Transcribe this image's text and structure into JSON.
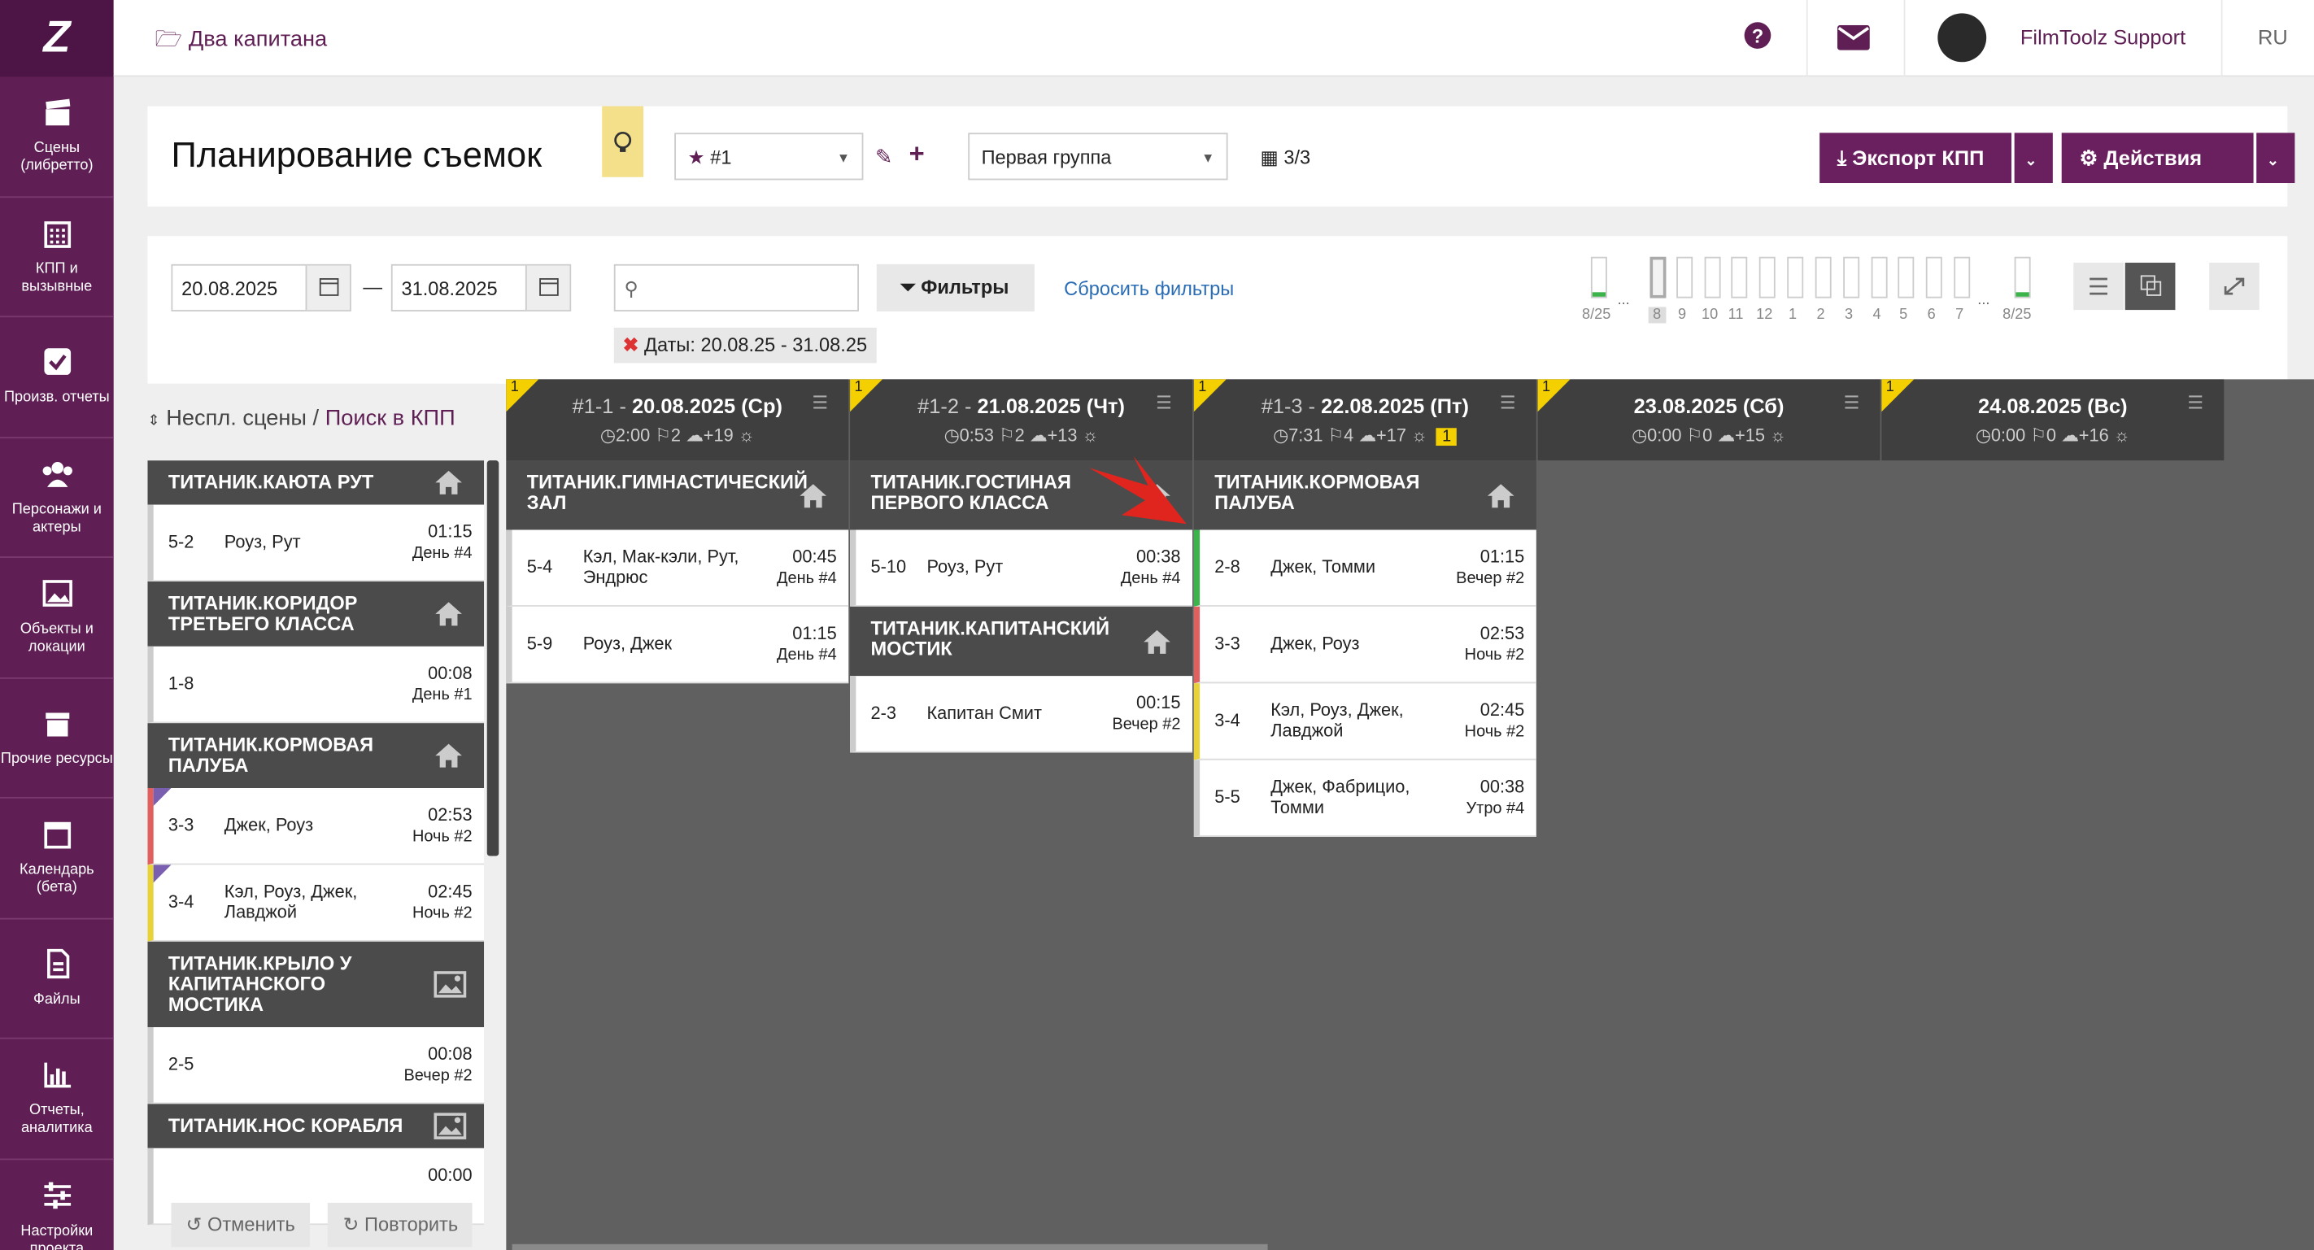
{
  "sidebar": {
    "logo": "Z",
    "items": [
      {
        "label": "Сцены (либретто)",
        "icon": "clapperboard-icon"
      },
      {
        "label": "КПП и вызывные",
        "icon": "calendar-grid-icon"
      },
      {
        "label": "Произв. отчеты",
        "icon": "checkbox-icon"
      },
      {
        "label": "Персонажи и актеры",
        "icon": "people-icon"
      },
      {
        "label": "Объекты и локации",
        "icon": "image-icon"
      },
      {
        "label": "Прочие ресурсы",
        "icon": "box-icon"
      },
      {
        "label": "Календарь (бета)",
        "icon": "calendar-icon"
      },
      {
        "label": "Файлы",
        "icon": "file-icon"
      },
      {
        "label": "Отчеты, аналитика",
        "icon": "bar-chart-icon"
      },
      {
        "label": "Настройки проекта",
        "icon": "sliders-icon"
      }
    ]
  },
  "topbar": {
    "project": "Два капитана",
    "user": "FilmToolz Support",
    "lang": "RU"
  },
  "header": {
    "title": "Планирование съемок",
    "schedule": "#1",
    "group": "Первая группа",
    "count": "3/3",
    "export": "Экспорт КПП",
    "actions": "Действия"
  },
  "filters": {
    "date_from": "20.08.2025",
    "date_to": "31.08.2025",
    "search_placeholder": "",
    "filter_btn": "Фильтры",
    "reset": "Сбросить фильтры",
    "tag": "Даты:  20.08.25 - 31.08.25"
  },
  "timeline": {
    "left": "8/25",
    "right": "8/25",
    "days": [
      "8",
      "9",
      "10",
      "11",
      "12",
      "1",
      "2",
      "3",
      "4",
      "5",
      "6",
      "7"
    ],
    "ellipsis": "..."
  },
  "left": {
    "header_a": "Неспл. сцены",
    "sep": " / ",
    "header_b": "Поиск в КПП",
    "groups": [
      {
        "loc": "ТИТАНИК.КАЮТА РУТ",
        "icon": "home-icon",
        "scenes": [
          {
            "n": "5-2",
            "c": "Роуз, Рут",
            "t": "01:15",
            "d": "День #4",
            "color": "#ccc",
            "mark": false
          }
        ]
      },
      {
        "loc": "ТИТАНИК.КОРИДОР ТРЕТЬЕГО КЛАССА",
        "icon": "home-icon",
        "scenes": [
          {
            "n": "1-8",
            "c": "",
            "t": "00:08",
            "d": "День #1",
            "color": "#ccc",
            "mark": false
          }
        ]
      },
      {
        "loc": "ТИТАНИК.КОРМОВАЯ ПАЛУБА",
        "icon": "home-icon",
        "scenes": [
          {
            "n": "3-3",
            "c": "Джек, Роуз",
            "t": "02:53",
            "d": "Ночь #2",
            "color": "#e06060",
            "mark": true
          },
          {
            "n": "3-4",
            "c": "Кэл, Роуз, Джек, Лавджой",
            "t": "02:45",
            "d": "Ночь #2",
            "color": "#e8d23a",
            "mark": true
          }
        ]
      },
      {
        "loc": "ТИТАНИК.КРЫЛО У КАПИТАНСКОГО МОСТИКА",
        "icon": "picture-icon",
        "scenes": [
          {
            "n": "2-5",
            "c": "",
            "t": "00:08",
            "d": "Вечер #2",
            "color": "#ccc",
            "mark": false
          }
        ]
      },
      {
        "loc": "ТИТАНИК.НОС КОРАБЛЯ",
        "icon": "picture-icon",
        "scenes": [
          {
            "n": "",
            "c": "",
            "t": "00:00",
            "d": "",
            "color": "#ccc",
            "mark": false
          }
        ]
      }
    ]
  },
  "days": [
    {
      "flag": "1",
      "prefix": "#1-1 - ",
      "date": "20.08.2025 (Ср)",
      "time": "2:00",
      "sc": "2",
      "w": "+19",
      "warn": "",
      "groups": [
        {
          "loc": "ТИТАНИК.ГИМНАСТИЧЕСКИЙ ЗАЛ",
          "scenes": [
            {
              "n": "5-4",
              "c": "Кэл, Мак-кэли, Рут, Эндрюс",
              "t": "00:45",
              "d": "День #4",
              "color": "#ccc"
            },
            {
              "n": "5-9",
              "c": "Роуз, Джек",
              "t": "01:15",
              "d": "День #4",
              "color": "#ccc"
            }
          ]
        }
      ]
    },
    {
      "flag": "1",
      "prefix": "#1-2 - ",
      "date": "21.08.2025 (Чт)",
      "time": "0:53",
      "sc": "2",
      "w": "+13",
      "warn": "",
      "groups": [
        {
          "loc": "ТИТАНИК.ГОСТИНАЯ ПЕРВОГО КЛАССА",
          "scenes": [
            {
              "n": "5-10",
              "c": "Роуз, Рут",
              "t": "00:38",
              "d": "День #4",
              "color": "#ccc"
            }
          ]
        },
        {
          "loc": "ТИТАНИК.КАПИТАНСКИЙ МОСТИК",
          "scenes": [
            {
              "n": "2-3",
              "c": "Капитан Смит",
              "t": "00:15",
              "d": "Вечер #2",
              "color": "#ccc"
            }
          ]
        }
      ]
    },
    {
      "flag": "1",
      "prefix": "#1-3 - ",
      "date": "22.08.2025 (Пт)",
      "time": "7:31",
      "sc": "4",
      "w": "+17",
      "warn": "1",
      "groups": [
        {
          "loc": "ТИТАНИК.КОРМОВАЯ ПАЛУБА",
          "scenes": [
            {
              "n": "2-8",
              "c": "Джек, Томми",
              "t": "01:15",
              "d": "Вечер #2",
              "color": "#3cb44b"
            },
            {
              "n": "3-3",
              "c": "Джек, Роуз",
              "t": "02:53",
              "d": "Ночь #2",
              "color": "#e06060"
            },
            {
              "n": "3-4",
              "c": "Кэл, Роуз, Джек, Лавджой",
              "t": "02:45",
              "d": "Ночь #2",
              "color": "#e8d23a"
            },
            {
              "n": "5-5",
              "c": "Джек, Фабрицио, Томми",
              "t": "00:38",
              "d": "Утро #4",
              "color": "#ccc"
            }
          ]
        }
      ]
    },
    {
      "flag": "1",
      "prefix": "",
      "date": "23.08.2025 (Сб)",
      "time": "0:00",
      "sc": "0",
      "w": "+15",
      "warn": "",
      "groups": []
    },
    {
      "flag": "1",
      "prefix": "",
      "date": "24.08.2025 (Вс)",
      "time": "0:00",
      "sc": "0",
      "w": "+16",
      "warn": "",
      "groups": []
    }
  ],
  "bottom": {
    "undo": "Отменить",
    "redo": "Повторить"
  },
  "colors": {
    "brand": "#5f1f55",
    "accent": "#6a1f5e",
    "flag": "#f4d000"
  }
}
